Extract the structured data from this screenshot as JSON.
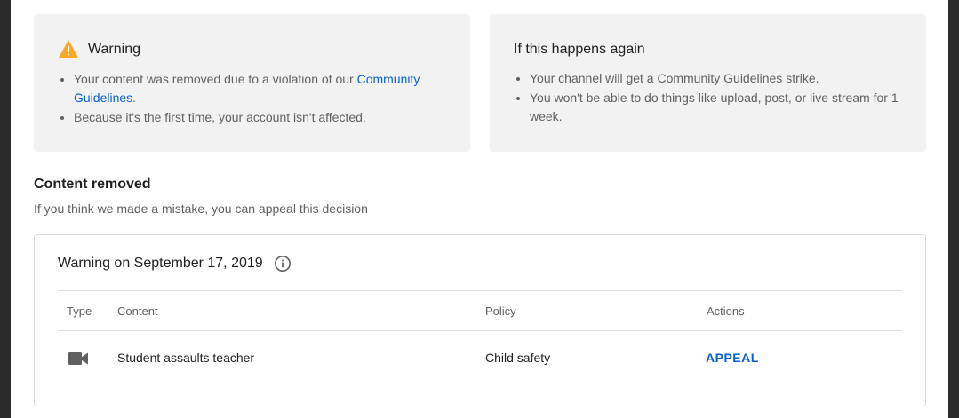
{
  "warning_card": {
    "title": "Warning",
    "bullet1_text": "Your content was removed due to a violation of our ",
    "bullet1_link": "Community Guidelines",
    "bullet1_end": ".",
    "bullet2": "Because it's the first time, your account isn't affected.",
    "icon": "warning-icon",
    "icon_color": "#f9a825"
  },
  "repeat_card": {
    "title": "If this happens again",
    "bullet1": "Your channel will get a Community Guidelines strike.",
    "bullet2": "You won't be able to do things like upload, post, or live stream for 1 week."
  },
  "content_removed": {
    "title": "Content removed",
    "subtitle": "If you think we made a mistake, you can appeal this decision"
  },
  "warning_panel": {
    "title": "Warning on September 17, 2019",
    "info_icon": "info-icon",
    "columns": {
      "type": "Type",
      "content": "Content",
      "policy": "Policy",
      "actions": "Actions"
    },
    "row": {
      "type_icon": "video-camera-icon",
      "content": "Student assaults teacher",
      "policy": "Child safety",
      "action": "APPEAL"
    }
  },
  "colors": {
    "link": "#065fd4",
    "card_bg": "#f2f2f2",
    "frame_bg": "#2b2b2b"
  }
}
